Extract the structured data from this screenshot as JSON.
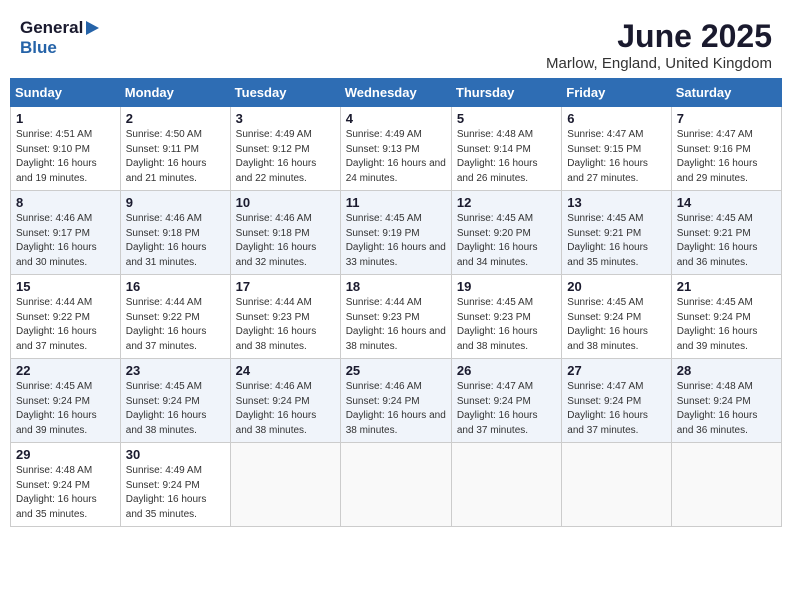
{
  "logo": {
    "general": "General",
    "blue": "Blue"
  },
  "title": "June 2025",
  "location": "Marlow, England, United Kingdom",
  "headers": [
    "Sunday",
    "Monday",
    "Tuesday",
    "Wednesday",
    "Thursday",
    "Friday",
    "Saturday"
  ],
  "weeks": [
    [
      {
        "day": "1",
        "sunrise": "Sunrise: 4:51 AM",
        "sunset": "Sunset: 9:10 PM",
        "daylight": "Daylight: 16 hours and 19 minutes."
      },
      {
        "day": "2",
        "sunrise": "Sunrise: 4:50 AM",
        "sunset": "Sunset: 9:11 PM",
        "daylight": "Daylight: 16 hours and 21 minutes."
      },
      {
        "day": "3",
        "sunrise": "Sunrise: 4:49 AM",
        "sunset": "Sunset: 9:12 PM",
        "daylight": "Daylight: 16 hours and 22 minutes."
      },
      {
        "day": "4",
        "sunrise": "Sunrise: 4:49 AM",
        "sunset": "Sunset: 9:13 PM",
        "daylight": "Daylight: 16 hours and 24 minutes."
      },
      {
        "day": "5",
        "sunrise": "Sunrise: 4:48 AM",
        "sunset": "Sunset: 9:14 PM",
        "daylight": "Daylight: 16 hours and 26 minutes."
      },
      {
        "day": "6",
        "sunrise": "Sunrise: 4:47 AM",
        "sunset": "Sunset: 9:15 PM",
        "daylight": "Daylight: 16 hours and 27 minutes."
      },
      {
        "day": "7",
        "sunrise": "Sunrise: 4:47 AM",
        "sunset": "Sunset: 9:16 PM",
        "daylight": "Daylight: 16 hours and 29 minutes."
      }
    ],
    [
      {
        "day": "8",
        "sunrise": "Sunrise: 4:46 AM",
        "sunset": "Sunset: 9:17 PM",
        "daylight": "Daylight: 16 hours and 30 minutes."
      },
      {
        "day": "9",
        "sunrise": "Sunrise: 4:46 AM",
        "sunset": "Sunset: 9:18 PM",
        "daylight": "Daylight: 16 hours and 31 minutes."
      },
      {
        "day": "10",
        "sunrise": "Sunrise: 4:46 AM",
        "sunset": "Sunset: 9:18 PM",
        "daylight": "Daylight: 16 hours and 32 minutes."
      },
      {
        "day": "11",
        "sunrise": "Sunrise: 4:45 AM",
        "sunset": "Sunset: 9:19 PM",
        "daylight": "Daylight: 16 hours and 33 minutes."
      },
      {
        "day": "12",
        "sunrise": "Sunrise: 4:45 AM",
        "sunset": "Sunset: 9:20 PM",
        "daylight": "Daylight: 16 hours and 34 minutes."
      },
      {
        "day": "13",
        "sunrise": "Sunrise: 4:45 AM",
        "sunset": "Sunset: 9:21 PM",
        "daylight": "Daylight: 16 hours and 35 minutes."
      },
      {
        "day": "14",
        "sunrise": "Sunrise: 4:45 AM",
        "sunset": "Sunset: 9:21 PM",
        "daylight": "Daylight: 16 hours and 36 minutes."
      }
    ],
    [
      {
        "day": "15",
        "sunrise": "Sunrise: 4:44 AM",
        "sunset": "Sunset: 9:22 PM",
        "daylight": "Daylight: 16 hours and 37 minutes."
      },
      {
        "day": "16",
        "sunrise": "Sunrise: 4:44 AM",
        "sunset": "Sunset: 9:22 PM",
        "daylight": "Daylight: 16 hours and 37 minutes."
      },
      {
        "day": "17",
        "sunrise": "Sunrise: 4:44 AM",
        "sunset": "Sunset: 9:23 PM",
        "daylight": "Daylight: 16 hours and 38 minutes."
      },
      {
        "day": "18",
        "sunrise": "Sunrise: 4:44 AM",
        "sunset": "Sunset: 9:23 PM",
        "daylight": "Daylight: 16 hours and 38 minutes."
      },
      {
        "day": "19",
        "sunrise": "Sunrise: 4:45 AM",
        "sunset": "Sunset: 9:23 PM",
        "daylight": "Daylight: 16 hours and 38 minutes."
      },
      {
        "day": "20",
        "sunrise": "Sunrise: 4:45 AM",
        "sunset": "Sunset: 9:24 PM",
        "daylight": "Daylight: 16 hours and 38 minutes."
      },
      {
        "day": "21",
        "sunrise": "Sunrise: 4:45 AM",
        "sunset": "Sunset: 9:24 PM",
        "daylight": "Daylight: 16 hours and 39 minutes."
      }
    ],
    [
      {
        "day": "22",
        "sunrise": "Sunrise: 4:45 AM",
        "sunset": "Sunset: 9:24 PM",
        "daylight": "Daylight: 16 hours and 39 minutes."
      },
      {
        "day": "23",
        "sunrise": "Sunrise: 4:45 AM",
        "sunset": "Sunset: 9:24 PM",
        "daylight": "Daylight: 16 hours and 38 minutes."
      },
      {
        "day": "24",
        "sunrise": "Sunrise: 4:46 AM",
        "sunset": "Sunset: 9:24 PM",
        "daylight": "Daylight: 16 hours and 38 minutes."
      },
      {
        "day": "25",
        "sunrise": "Sunrise: 4:46 AM",
        "sunset": "Sunset: 9:24 PM",
        "daylight": "Daylight: 16 hours and 38 minutes."
      },
      {
        "day": "26",
        "sunrise": "Sunrise: 4:47 AM",
        "sunset": "Sunset: 9:24 PM",
        "daylight": "Daylight: 16 hours and 37 minutes."
      },
      {
        "day": "27",
        "sunrise": "Sunrise: 4:47 AM",
        "sunset": "Sunset: 9:24 PM",
        "daylight": "Daylight: 16 hours and 37 minutes."
      },
      {
        "day": "28",
        "sunrise": "Sunrise: 4:48 AM",
        "sunset": "Sunset: 9:24 PM",
        "daylight": "Daylight: 16 hours and 36 minutes."
      }
    ],
    [
      {
        "day": "29",
        "sunrise": "Sunrise: 4:48 AM",
        "sunset": "Sunset: 9:24 PM",
        "daylight": "Daylight: 16 hours and 35 minutes."
      },
      {
        "day": "30",
        "sunrise": "Sunrise: 4:49 AM",
        "sunset": "Sunset: 9:24 PM",
        "daylight": "Daylight: 16 hours and 35 minutes."
      },
      null,
      null,
      null,
      null,
      null
    ]
  ]
}
